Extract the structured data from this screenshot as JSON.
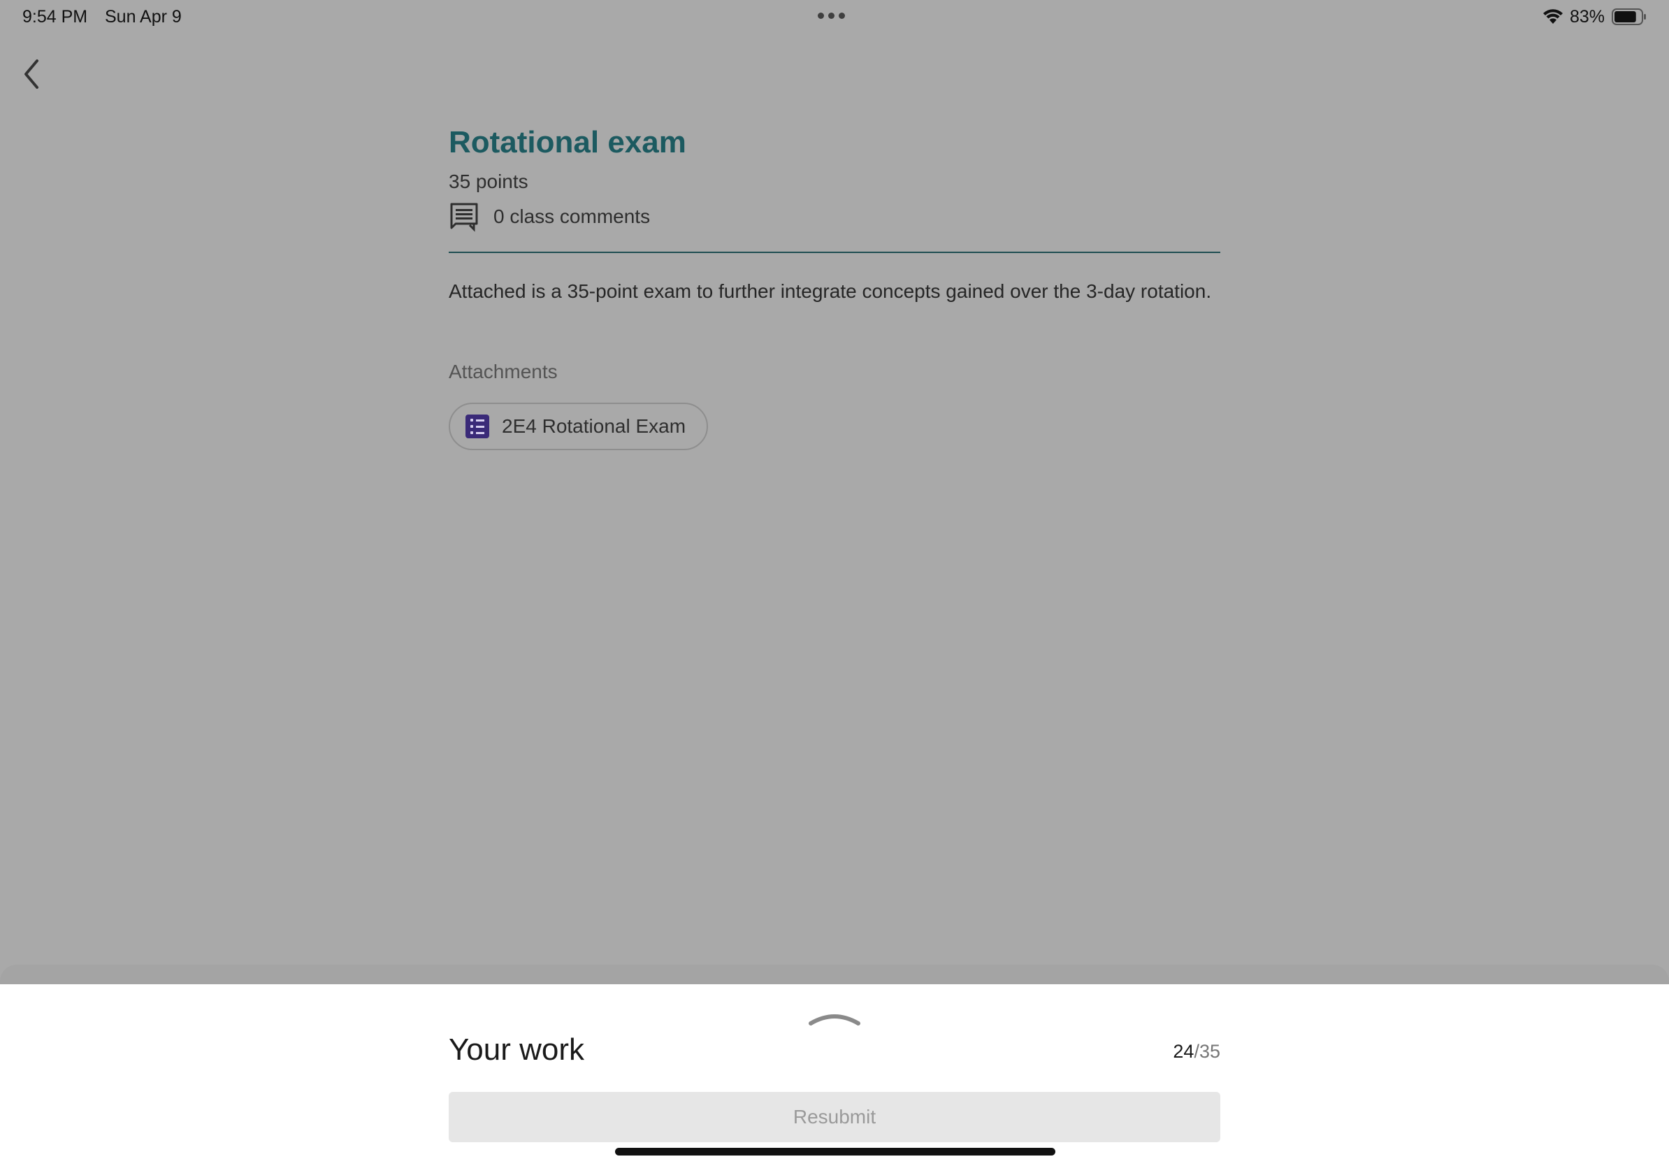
{
  "status_bar": {
    "time": "9:54 PM",
    "date": "Sun Apr 9",
    "battery_percent": "83%",
    "battery_level": 0.83
  },
  "assignment": {
    "title": "Rotational exam",
    "points": "35 points",
    "comments": "0 class comments",
    "description": "Attached is a 35-point exam to further integrate concepts gained over the 3-day rotation.",
    "attachments_label": "Attachments",
    "attachments": [
      {
        "label": "2E4 Rotational Exam",
        "icon": "google-forms-icon"
      }
    ]
  },
  "your_work": {
    "heading": "Your work",
    "grade_value": "24",
    "grade_separator": "/",
    "grade_total": "35",
    "resubmit_label": "Resubmit"
  },
  "colors": {
    "title": "#1c5a60",
    "overlay_background": "#a9a9a9",
    "forms_icon": "#3a2a78"
  }
}
